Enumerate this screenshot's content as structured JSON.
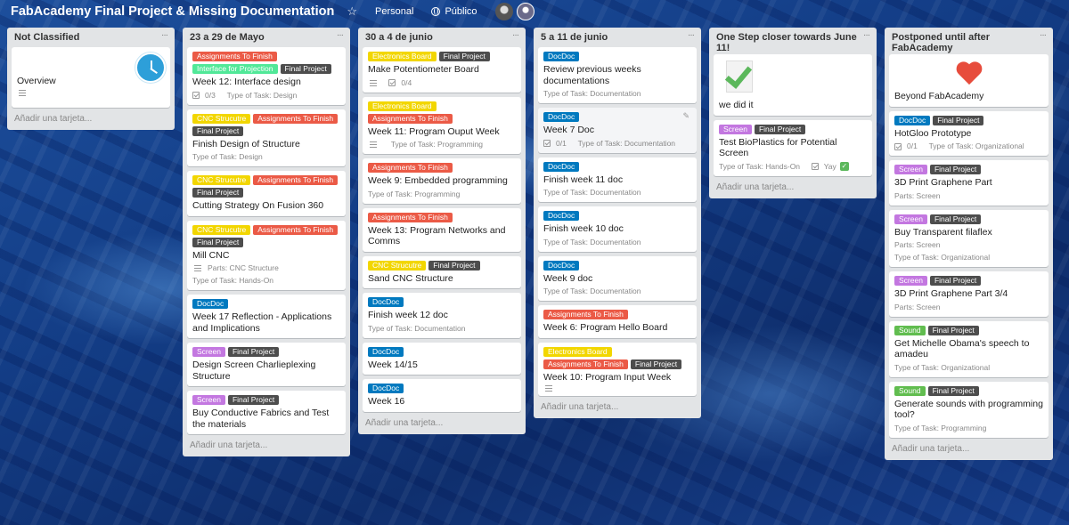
{
  "header": {
    "board_title": "FabAcademy Final Project & Missing Documentation",
    "team": "Personal",
    "visibility": "Público"
  },
  "add_card_label": "Añadir una tarjeta...",
  "lists": [
    {
      "title": "Not Classified",
      "cards": [
        {
          "title": "Overview",
          "labels": [],
          "has_desc": true
        }
      ]
    },
    {
      "title": "23 a 29 de Mayo",
      "cards": [
        {
          "labels": [
            {
              "text": "Assignments To Finish",
              "color": "red"
            },
            {
              "text": "Interface for Projection",
              "color": "lime"
            },
            {
              "text": "Final Project",
              "color": "black"
            }
          ],
          "title": "Week 12: Interface design",
          "checklist": "0/3",
          "type": "Type of Task: Design"
        },
        {
          "labels": [
            {
              "text": "CNC Strucutre",
              "color": "yellow"
            },
            {
              "text": "Assignments To Finish",
              "color": "red"
            },
            {
              "text": "Final Project",
              "color": "black"
            }
          ],
          "title": "Finish Design of Structure",
          "type": "Type of Task: Design"
        },
        {
          "labels": [
            {
              "text": "CNC Strucutre",
              "color": "yellow"
            },
            {
              "text": "Assignments To Finish",
              "color": "red"
            },
            {
              "text": "Final Project",
              "color": "black"
            }
          ],
          "title": "Cutting Strategy On Fusion 360"
        },
        {
          "labels": [
            {
              "text": "CNC Strucutre",
              "color": "yellow"
            },
            {
              "text": "Assignments To Finish",
              "color": "red"
            },
            {
              "text": "Final Project",
              "color": "black"
            }
          ],
          "title": "Mill CNC",
          "parts": "Parts: CNC Structure",
          "type": "Type of Task: Hands-On"
        },
        {
          "labels": [
            {
              "text": "DocDoc",
              "color": "blue"
            }
          ],
          "title": "Week 17 Reflection - Applications and Implications"
        },
        {
          "labels": [
            {
              "text": "Screen",
              "color": "purple"
            },
            {
              "text": "Final Project",
              "color": "black"
            }
          ],
          "title": "Design Screen Charlieplexing Structure"
        },
        {
          "labels": [
            {
              "text": "Screen",
              "color": "purple"
            },
            {
              "text": "Final Project",
              "color": "black"
            }
          ],
          "title": "Buy Conductive Fabrics and Test the materials"
        }
      ]
    },
    {
      "title": "30 a 4 de junio",
      "cards": [
        {
          "labels": [
            {
              "text": "Electronics Board",
              "color": "yellow"
            },
            {
              "text": "Final Project",
              "color": "black"
            }
          ],
          "title": "Make Potentiometer Board",
          "checklist": "0/4"
        },
        {
          "labels": [
            {
              "text": "Electronics Board",
              "color": "yellow"
            },
            {
              "text": "Assignments To Finish",
              "color": "red"
            }
          ],
          "title": "Week 11: Program Ouput Week",
          "type": "Type of Task: Programming"
        },
        {
          "labels": [
            {
              "text": "Assignments To Finish",
              "color": "red"
            }
          ],
          "title": "Week 9: Embedded programming",
          "type": "Type of Task: Programming"
        },
        {
          "labels": [
            {
              "text": "Assignments To Finish",
              "color": "red"
            }
          ],
          "title": "Week 13: Program Networks and Comms"
        },
        {
          "labels": [
            {
              "text": "CNC Strucutre",
              "color": "yellow"
            },
            {
              "text": "Final Project",
              "color": "black"
            }
          ],
          "title": "Sand CNC Structure"
        },
        {
          "labels": [
            {
              "text": "DocDoc",
              "color": "blue"
            }
          ],
          "title": "Finish week 12 doc",
          "type": "Type of Task: Documentation"
        },
        {
          "labels": [
            {
              "text": "DocDoc",
              "color": "blue"
            }
          ],
          "title": "Week 14/15"
        },
        {
          "labels": [
            {
              "text": "DocDoc",
              "color": "blue"
            }
          ],
          "title": "Week 16"
        }
      ]
    },
    {
      "title": "5 a 11 de junio",
      "cards": [
        {
          "labels": [
            {
              "text": "DocDoc",
              "color": "blue"
            }
          ],
          "title": "Review previous weeks documentations",
          "type": "Type of Task: Documentation"
        },
        {
          "labels": [
            {
              "text": "DocDoc",
              "color": "blue"
            }
          ],
          "title": "Week 7 Doc",
          "checklist": "0/1",
          "type": "Type of Task: Documentation"
        },
        {
          "labels": [
            {
              "text": "DocDoc",
              "color": "blue"
            }
          ],
          "title": "Finish week 11 doc",
          "type": "Type of Task: Documentation"
        },
        {
          "labels": [
            {
              "text": "DocDoc",
              "color": "blue"
            }
          ],
          "title": "Finish week 10 doc",
          "type": "Type of Task: Documentation"
        },
        {
          "labels": [
            {
              "text": "DocDoc",
              "color": "blue"
            }
          ],
          "title": "Week 9 doc",
          "type": "Type of Task: Documentation"
        },
        {
          "labels": [
            {
              "text": "Assignments To Finish",
              "color": "red"
            }
          ],
          "title": "Week 6: Program Hello Board"
        },
        {
          "labels": [
            {
              "text": "Electronics Board",
              "color": "yellow"
            },
            {
              "text": "Assignments To Finish",
              "color": "red"
            },
            {
              "text": "Final Project",
              "color": "black"
            }
          ],
          "title": "Week 10: Program Input Week"
        }
      ]
    },
    {
      "title": "One Step closer towards June 11!",
      "cards": [
        {
          "title": "we did it"
        },
        {
          "labels": [
            {
              "text": "Screen",
              "color": "purple"
            },
            {
              "text": "Final Project",
              "color": "black"
            }
          ],
          "title": "Test BioPlastics for Potential Screen",
          "type": "Type of Task: Hands-On",
          "extra": "Yay"
        }
      ]
    },
    {
      "title": "Postponed until after FabAcademy",
      "cards": [
        {
          "title": "Beyond FabAcademy"
        },
        {
          "labels": [
            {
              "text": "DocDoc",
              "color": "blue"
            },
            {
              "text": "Final Project",
              "color": "black"
            }
          ],
          "title": "HotGloo Prototype",
          "checklist": "0/1",
          "type": "Type of Task: Organizational"
        },
        {
          "labels": [
            {
              "text": "Screen",
              "color": "purple"
            },
            {
              "text": "Final Project",
              "color": "black"
            }
          ],
          "title": "3D Print Graphene Part",
          "parts": "Parts: Screen"
        },
        {
          "labels": [
            {
              "text": "Screen",
              "color": "purple"
            },
            {
              "text": "Final Project",
              "color": "black"
            }
          ],
          "title": "Buy Transparent filaflex",
          "parts": "Parts: Screen",
          "type": "Type of Task: Organizational"
        },
        {
          "labels": [
            {
              "text": "Screen",
              "color": "purple"
            },
            {
              "text": "Final Project",
              "color": "black"
            }
          ],
          "title": "3D Print Graphene Part 3/4",
          "parts": "Parts: Screen"
        },
        {
          "labels": [
            {
              "text": "Sound",
              "color": "green"
            },
            {
              "text": "Final Project",
              "color": "black"
            }
          ],
          "title": "Get Michelle Obama's speech to amadeu",
          "type": "Type of Task: Organizational"
        },
        {
          "labels": [
            {
              "text": "Sound",
              "color": "green"
            },
            {
              "text": "Final Project",
              "color": "black"
            }
          ],
          "title": "Generate sounds with programming tool?",
          "type": "Type of Task: Programming"
        }
      ]
    }
  ]
}
